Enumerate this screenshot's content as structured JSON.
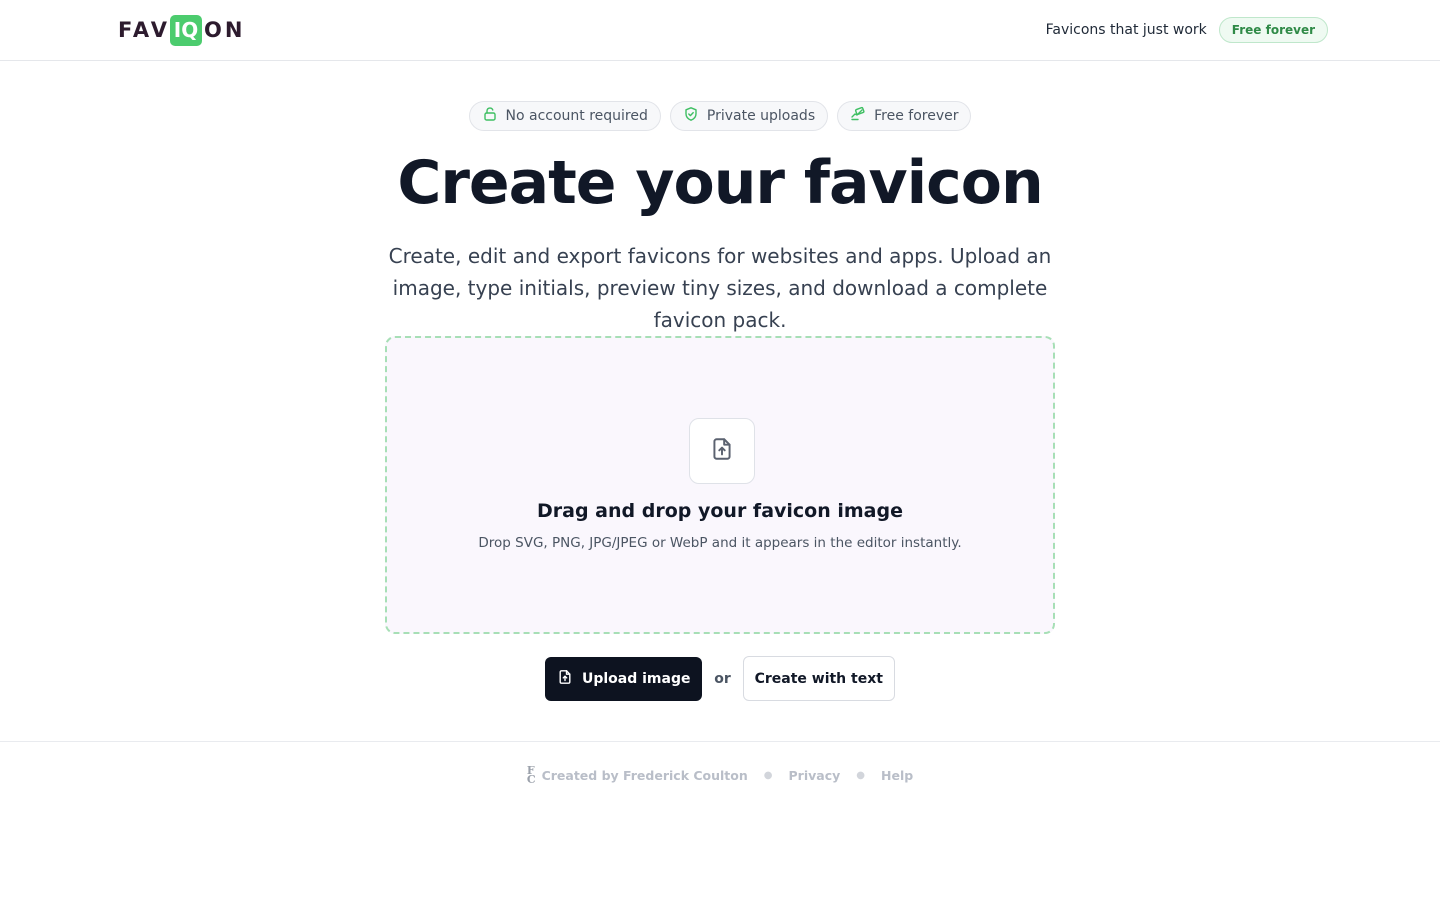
{
  "header": {
    "logo": {
      "part1": "FAV",
      "highlight": "IQ",
      "part2": "ON"
    },
    "tagline": "Favicons that just work",
    "badge": "Free forever"
  },
  "badges": [
    {
      "icon": "lock-open-icon",
      "label": "No account required"
    },
    {
      "icon": "shield-check-icon",
      "label": "Private uploads"
    },
    {
      "icon": "money-hand-icon",
      "label": "Free forever"
    }
  ],
  "hero": {
    "title": "Create your favicon",
    "subtitle": "Create, edit and export favicons for websites and apps. Upload an image, type initials, preview tiny sizes, and download a complete favicon pack."
  },
  "dropzone": {
    "icon": "file-upload-icon",
    "title": "Drag and drop your favicon image",
    "subtitle": "Drop SVG, PNG, JPG/JPEG or WebP and it appears in the editor instantly."
  },
  "actions": {
    "upload_label": "Upload image",
    "or_label": "or",
    "text_label": "Create with text"
  },
  "footer": {
    "creator_mark_top": "F",
    "creator_mark_bottom": "C",
    "creator": "Created by Frederick Coulton",
    "privacy": "Privacy",
    "help": "Help"
  },
  "colors": {
    "brand_green": "#4ccc6e",
    "logo_dark": "#2d1b2e",
    "primary_button": "#0d1320",
    "dropzone_bg": "#faf7fd",
    "dropzone_border": "#a7dfb6"
  }
}
